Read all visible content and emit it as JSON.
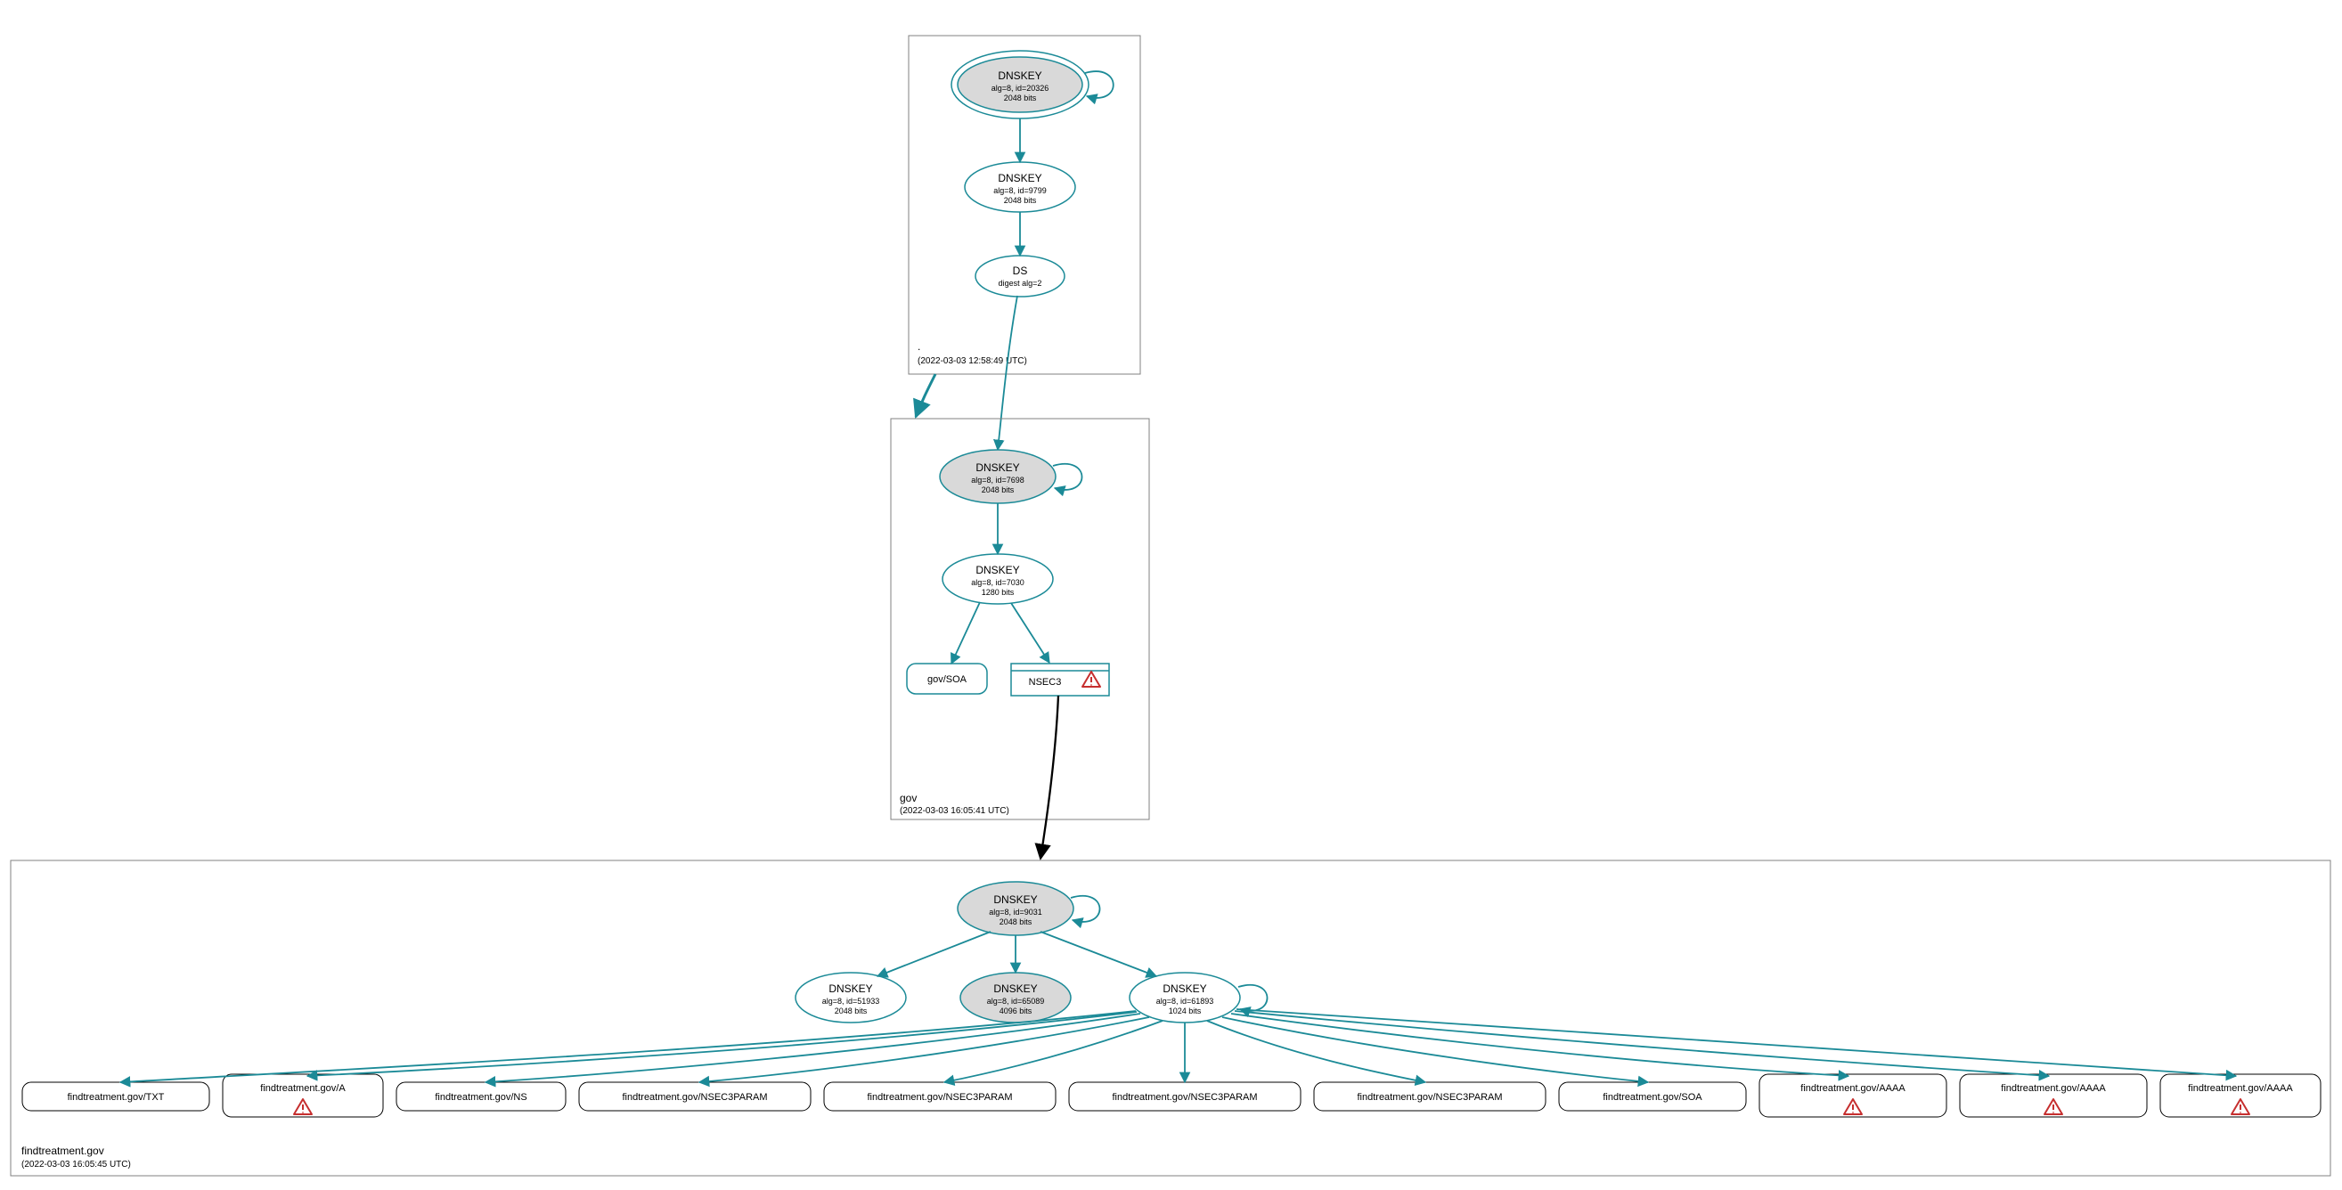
{
  "zones": {
    "root": {
      "label": ".",
      "timestamp": "(2022-03-03 12:58:49 UTC)"
    },
    "gov": {
      "label": "gov",
      "timestamp": "(2022-03-03 16:05:41 UTC)"
    },
    "ft": {
      "label": "findtreatment.gov",
      "timestamp": "(2022-03-03 16:05:45 UTC)"
    }
  },
  "nodes": {
    "root_ksk": {
      "title": "DNSKEY",
      "sub1": "alg=8, id=20326",
      "sub2": "2048 bits"
    },
    "root_zsk": {
      "title": "DNSKEY",
      "sub1": "alg=8, id=9799",
      "sub2": "2048 bits"
    },
    "root_ds": {
      "title": "DS",
      "sub1": "digest alg=2",
      "sub2": ""
    },
    "gov_ksk": {
      "title": "DNSKEY",
      "sub1": "alg=8, id=7698",
      "sub2": "2048 bits"
    },
    "gov_zsk": {
      "title": "DNSKEY",
      "sub1": "alg=8, id=7030",
      "sub2": "1280 bits"
    },
    "gov_soa": {
      "title": "gov/SOA"
    },
    "gov_nsec3": {
      "title": "NSEC3"
    },
    "ft_ksk": {
      "title": "DNSKEY",
      "sub1": "alg=8, id=9031",
      "sub2": "2048 bits"
    },
    "ft_k2": {
      "title": "DNSKEY",
      "sub1": "alg=8, id=51933",
      "sub2": "2048 bits"
    },
    "ft_k3": {
      "title": "DNSKEY",
      "sub1": "alg=8, id=65089",
      "sub2": "4096 bits"
    },
    "ft_k4": {
      "title": "DNSKEY",
      "sub1": "alg=8, id=61893",
      "sub2": "1024 bits"
    }
  },
  "records": {
    "r0": "findtreatment.gov/TXT",
    "r1": "findtreatment.gov/A",
    "r2": "findtreatment.gov/NS",
    "r3": "findtreatment.gov/NSEC3PARAM",
    "r4": "findtreatment.gov/NSEC3PARAM",
    "r5": "findtreatment.gov/NSEC3PARAM",
    "r6": "findtreatment.gov/NSEC3PARAM",
    "r7": "findtreatment.gov/SOA",
    "r8": "findtreatment.gov/AAAA",
    "r9": "findtreatment.gov/AAAA",
    "r10": "findtreatment.gov/AAAA"
  },
  "colors": {
    "teal": "#1b8a97",
    "nodeGray": "#d9d9d9",
    "warn": "#c62f2f"
  }
}
